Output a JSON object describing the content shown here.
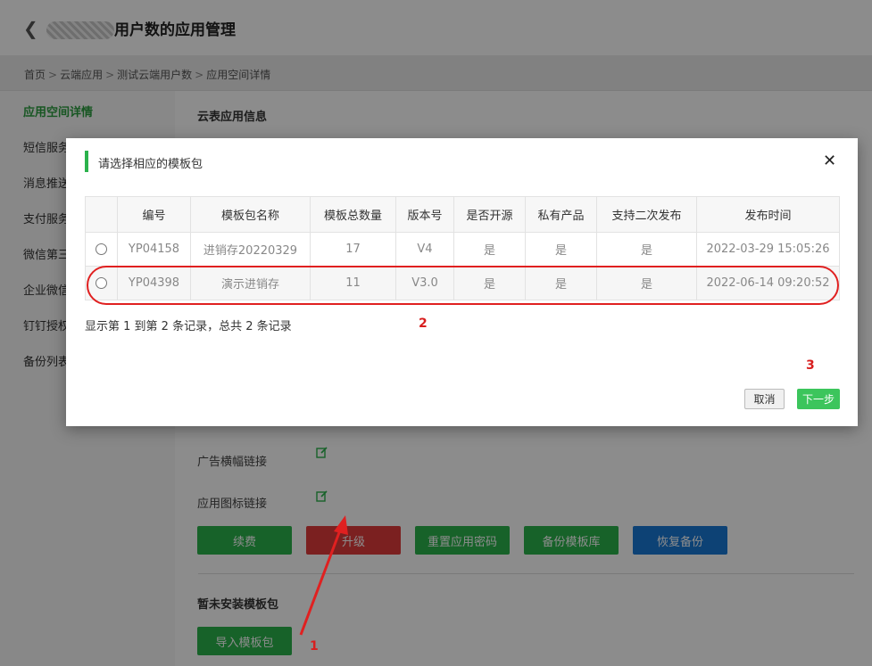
{
  "header": {
    "title": "用户数的应用管理"
  },
  "breadcrumb": [
    "首页",
    "云端应用",
    "测试云端用户数",
    "应用空间详情"
  ],
  "sidebar": {
    "items": [
      {
        "label": "应用空间详情",
        "active": true
      },
      {
        "label": "短信服务"
      },
      {
        "label": "消息推送"
      },
      {
        "label": "支付服务"
      },
      {
        "label": "微信第三"
      },
      {
        "label": "企业微信"
      },
      {
        "label": "钉钉授权"
      },
      {
        "label": "备份列表"
      }
    ]
  },
  "content": {
    "section_title": "云表应用信息",
    "fields": {
      "ad_banner_label": "广告横幅链接",
      "app_icon_label": "应用图标链接"
    },
    "actions": {
      "renew": "续费",
      "upgrade": "升级",
      "reset_password": "重置应用密码",
      "backup_templates": "备份模板库",
      "restore_backup": "恢复备份"
    },
    "no_template_title": "暂未安装模板包",
    "import_button": "导入模板包"
  },
  "modal": {
    "title": "请选择相应的模板包",
    "columns": [
      "编号",
      "模板包名称",
      "模板总数量",
      "版本号",
      "是否开源",
      "私有产品",
      "支持二次发布",
      "发布时间"
    ],
    "rows": [
      [
        "YP04158",
        "进销存20220329",
        "17",
        "V4",
        "是",
        "是",
        "是",
        "2022-03-29 15:05:26"
      ],
      [
        "YP04398",
        "演示进销存",
        "11",
        "V3.0",
        "是",
        "是",
        "是",
        "2022-06-14 09:20:52"
      ]
    ],
    "records_text": "显示第 1 到第 2 条记录，总共 2 条记录",
    "cancel": "取消",
    "next": "下一步"
  },
  "annotations": {
    "n1": "1",
    "n2": "2",
    "n3": "3",
    "color": "#d81e1e"
  },
  "colors": {
    "primary_green": "#2bb24c",
    "danger_red": "#e03b3b",
    "info_blue": "#1878d6"
  }
}
